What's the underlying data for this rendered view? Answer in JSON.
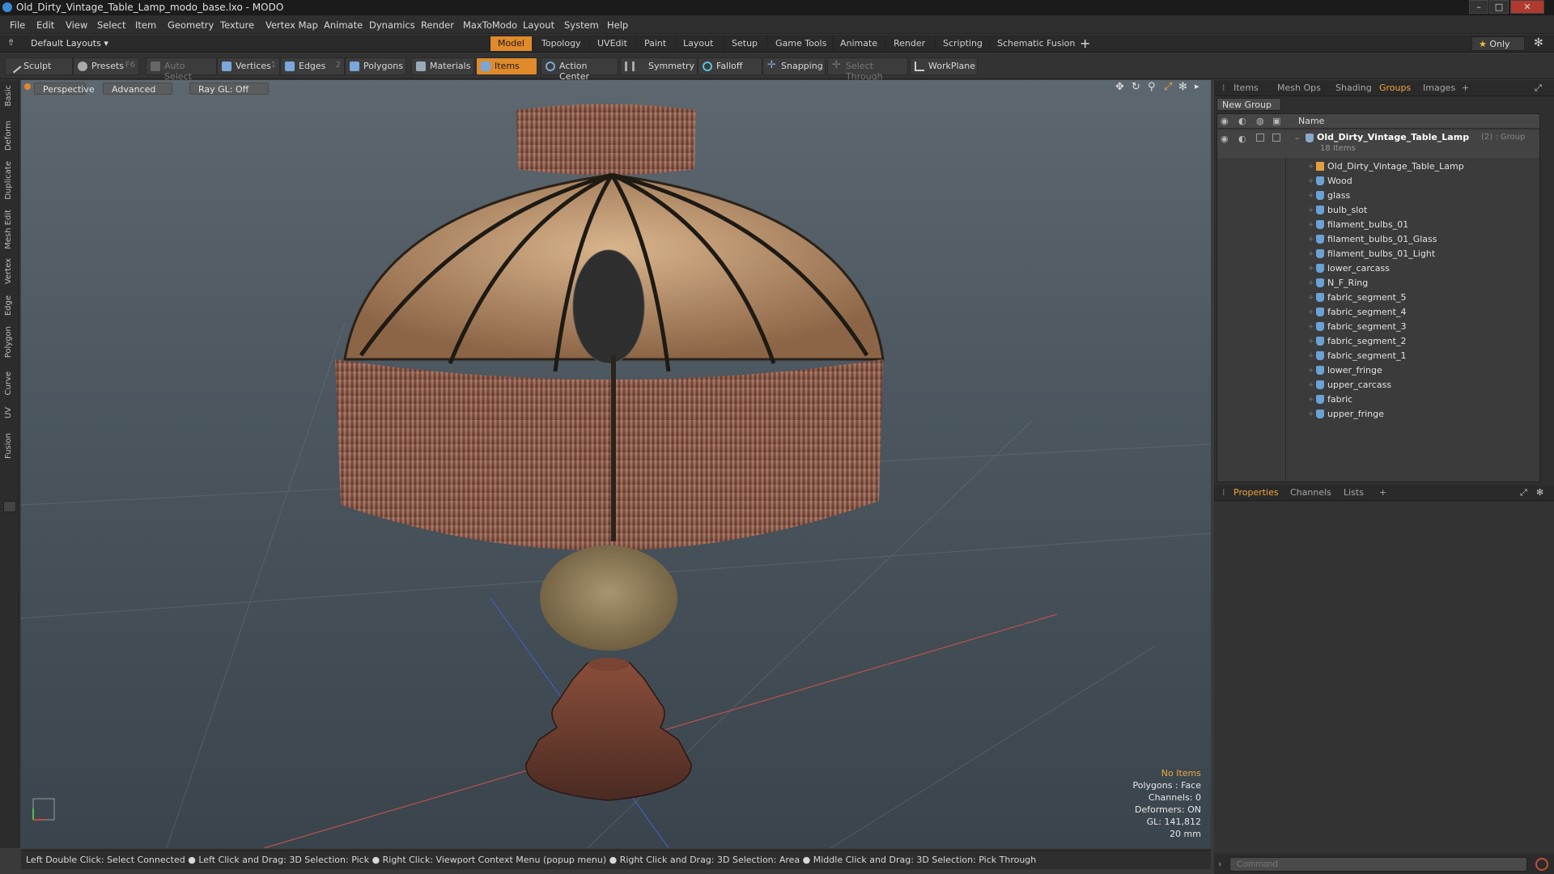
{
  "window": {
    "title": "Old_Dirty_Vintage_Table_Lamp_modo_base.lxo - MODO"
  },
  "menu": [
    "File",
    "Edit",
    "View",
    "Select",
    "Item",
    "Geometry",
    "Texture",
    "Vertex Map",
    "Animate",
    "Dynamics",
    "Render",
    "MaxToModo",
    "Layout",
    "System",
    "Help"
  ],
  "layout_selector": "Default Layouts",
  "mode_tabs": [
    "Model",
    "Topology",
    "UVEdit",
    "Paint",
    "Layout",
    "Setup",
    "Game Tools",
    "Animate",
    "Render",
    "Scripting",
    "Schematic Fusion"
  ],
  "mode_active": "Model",
  "only_label": "Only",
  "toolbar": {
    "sculpt": "Sculpt",
    "presets": "Presets",
    "presets_key": "F6",
    "auto_select": "Auto Select",
    "vertices": "Vertices",
    "vertices_key": "1",
    "edges": "Edges",
    "edges_key": "2",
    "polygons": "Polygons",
    "materials": "Materials",
    "items": "Items",
    "action_center": "Action Center",
    "symmetry": "Symmetry",
    "falloff": "Falloff",
    "snapping": "Snapping",
    "select_through": "Select Through",
    "workplane": "WorkPlane"
  },
  "left_tabs": [
    "Basic",
    "Deform",
    "Duplicate",
    "Mesh Edit",
    "Vertex",
    "Edge",
    "Polygon",
    "Curve",
    "UV",
    "Fusion"
  ],
  "viewport": {
    "perspective": "Perspective",
    "advanced": "Advanced",
    "raygl": "Ray GL: Off",
    "stats": {
      "no_items": "No Items",
      "polygons": "Polygons : Face",
      "channels": "Channels: 0",
      "deformers": "Deformers: ON",
      "gl": "GL: 141,812",
      "size": "20 mm"
    }
  },
  "status_bar": "Left Double Click: Select Connected ● Left Click and Drag: 3D Selection: Pick ● Right Click: Viewport Context Menu (popup menu) ● Right Click and Drag: 3D Selection: Area ● Middle Click and Drag: 3D Selection: Pick Through",
  "right_tabs": [
    "Items",
    "Mesh Ops",
    "Shading",
    "Groups",
    "Images"
  ],
  "right_tab_active": "Groups",
  "new_group": "New Group",
  "name_header": "Name",
  "group": {
    "name": "Old_Dirty_Vintage_Table_Lamp",
    "count_suffix": "(2) : Group",
    "items_count": "18 Items"
  },
  "group_items": [
    "Old_Dirty_Vintage_Table_Lamp",
    "Wood",
    "glass",
    "bulb_slot",
    "filament_bulbs_01",
    "filament_bulbs_01_Glass",
    "filament_bulbs_01_Light",
    "lower_carcass",
    "N_F_Ring",
    "fabric_segment_5",
    "fabric_segment_4",
    "fabric_segment_3",
    "fabric_segment_2",
    "fabric_segment_1",
    "lower_fringe",
    "upper_carcass",
    "fabric",
    "upper_fringe"
  ],
  "bottom_tabs": [
    "Properties",
    "Channels",
    "Lists"
  ],
  "bottom_tab_active": "Properties",
  "command_placeholder": "Command",
  "colors": {
    "accent": "#e08a2b",
    "mesh_icon": "#6aa2d6"
  }
}
